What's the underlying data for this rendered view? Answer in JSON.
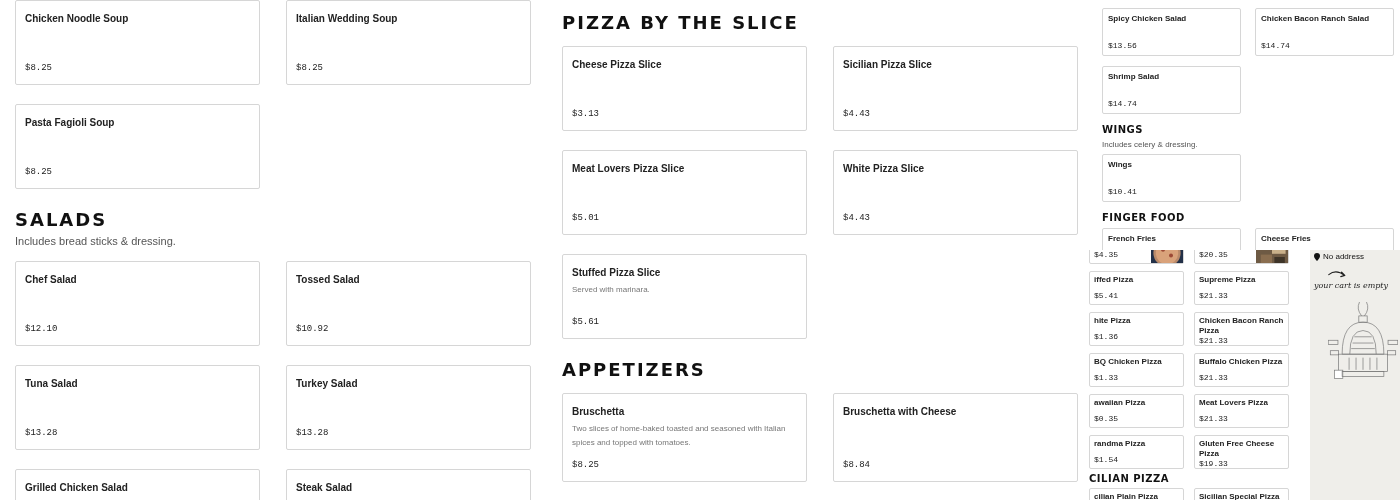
{
  "menu": {
    "columns": [
      {
        "sections": [
          {
            "items": [
              {
                "name": "Chicken Noodle Soup",
                "price": "$8.25"
              },
              {
                "name": "Italian Wedding Soup",
                "price": "$8.25"
              },
              {
                "name": "Pasta Fagioli Soup",
                "price": "$8.25"
              }
            ]
          },
          {
            "title": "SALADS",
            "subtitle": "Includes bread sticks & dressing.",
            "items": [
              {
                "name": "Chef Salad",
                "price": "$12.10"
              },
              {
                "name": "Tossed Salad",
                "price": "$10.92"
              },
              {
                "name": "Tuna Salad",
                "price": "$13.28"
              },
              {
                "name": "Turkey Salad",
                "price": "$13.28"
              },
              {
                "name": "Grilled Chicken Salad"
              },
              {
                "name": "Steak Salad"
              }
            ]
          }
        ]
      },
      {
        "sections": [
          {
            "title": "PIZZA BY THE SLICE",
            "items": [
              {
                "name": "Cheese Pizza Slice",
                "price": "$3.13"
              },
              {
                "name": "Sicilian Pizza Slice",
                "price": "$4.43"
              },
              {
                "name": "Meat Lovers Pizza Slice",
                "price": "$5.01"
              },
              {
                "name": "White Pizza Slice",
                "price": "$4.43"
              },
              {
                "name": "Stuffed Pizza Slice",
                "description": "Served with marinara.",
                "price": "$5.61"
              }
            ]
          },
          {
            "title": "APPETIZERS",
            "items": [
              {
                "name": "Bruschetta",
                "description": "Two slices of home-baked toasted and seasoned with Italian spices and topped with tomatoes.",
                "price": "$8.25"
              },
              {
                "name": "Bruschetta with Cheese",
                "price": "$8.84"
              }
            ]
          }
        ]
      }
    ]
  },
  "preview_top": {
    "sections": [
      {
        "items": [
          {
            "name": "Spicy Chicken Salad",
            "price": "$13.56"
          },
          {
            "name": "Chicken Bacon Ranch Salad",
            "price": "$14.74"
          },
          {
            "name": "Shrimp Salad",
            "price": "$14.74"
          }
        ]
      },
      {
        "title": "WINGS",
        "subtitle": "Includes celery & dressing.",
        "items": [
          {
            "name": "Wings",
            "price": "$10.41"
          }
        ]
      },
      {
        "title": "FINGER FOOD",
        "items": [
          {
            "name": "French Fries"
          },
          {
            "name": "Cheese Fries"
          }
        ]
      }
    ]
  },
  "preview_bottom": {
    "sections": [
      {
        "items": [
          {
            "price": "$4.35"
          },
          {
            "price": "$20.35"
          },
          {
            "name": "iffed Pizza",
            "price": "$5.41"
          },
          {
            "name": "Supreme Pizza",
            "price": "$21.33"
          },
          {
            "name": "hite Pizza",
            "price": "$1.36"
          },
          {
            "name": "Chicken Bacon Ranch Pizza",
            "price": "$21.33"
          },
          {
            "name": "BQ Chicken Pizza",
            "price": "$1.33"
          },
          {
            "name": "Buffalo Chicken Pizza",
            "price": "$21.33"
          },
          {
            "name": "awaiian Pizza",
            "price": "$0.35"
          },
          {
            "name": "Meat Lovers Pizza",
            "price": "$21.33"
          },
          {
            "name": "randma Pizza",
            "price": "$1.54"
          },
          {
            "name": "Gluten Free Cheese Pizza",
            "price": "$19.33"
          }
        ]
      },
      {
        "title": "CILIAN PIZZA",
        "items": [
          {
            "name": "cilian Plain Pizza"
          },
          {
            "name": "Sicilian Special Pizza"
          }
        ]
      }
    ]
  },
  "cart": {
    "address": "No address",
    "message": "your cart is empty"
  }
}
